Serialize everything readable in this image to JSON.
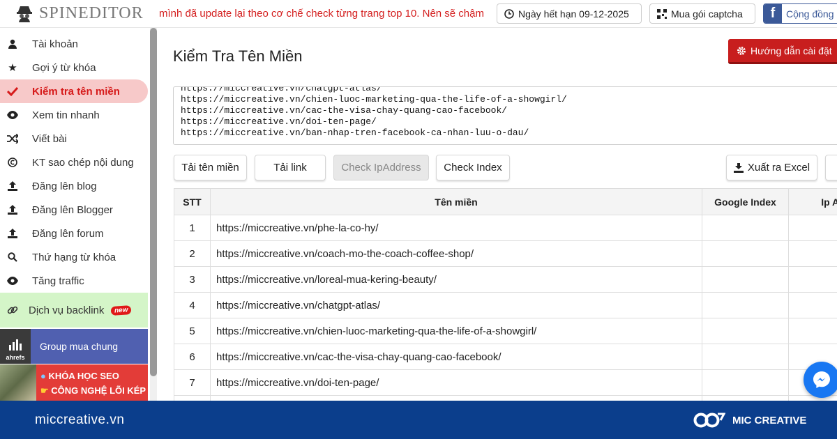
{
  "header": {
    "logo_text": "SPINEDITOR",
    "notice": "mình đã update lại theo cơ chế check từng trang top 10. Nên sẽ chậm",
    "expiry_label": "Ngày hết hạn 09-12-2025",
    "captcha_label": "Mua gói captcha",
    "community_label": "Cộng đồng S"
  },
  "sidebar": {
    "items": [
      {
        "label": "Tài khoản",
        "icon": "user-icon"
      },
      {
        "label": "Gợi ý từ khóa",
        "icon": "star-icon"
      },
      {
        "label": "Kiểm tra tên miền",
        "icon": "check-icon",
        "active": true
      },
      {
        "label": "Xem tin nhanh",
        "icon": "eye-icon"
      },
      {
        "label": "Viết bài",
        "icon": "shuffle-icon"
      },
      {
        "label": "KT sao chép nội dung",
        "icon": "copyright-icon"
      },
      {
        "label": "Đăng lên blog",
        "icon": "upload-icon"
      },
      {
        "label": "Đăng lên Blogger",
        "icon": "upload-icon"
      },
      {
        "label": "Đăng lên forum",
        "icon": "upload-icon"
      },
      {
        "label": "Thứ hạng từ khóa",
        "icon": "search-icon"
      },
      {
        "label": "Tăng traffic",
        "icon": "eye-icon"
      }
    ],
    "backlink_label": "Dịch vụ backlink",
    "new_badge": "new",
    "group_label": "Group mua chung",
    "ahrefs_label": "ahrefs",
    "seo_line1": "KHÓA HỌC SEO",
    "seo_line2": "CÔNG NGHỆ LÕI KÉP"
  },
  "main": {
    "title": "Kiểm Tra Tên Miền",
    "guide_button": "Hướng dẫn cài đặt",
    "url_lines": [
      "https://miccreative.vn/chatgpt-atlas/",
      "https://miccreative.vn/chien-luoc-marketing-qua-the-life-of-a-showgirl/",
      "https://miccreative.vn/cac-the-visa-chay-quang-cao-facebook/",
      "https://miccreative.vn/doi-ten-page/",
      "https://miccreative.vn/ban-nhap-tren-facebook-ca-nhan-luu-o-dau/"
    ],
    "buttons": {
      "load_domains": "Tải tên miền",
      "load_links": "Tải link",
      "check_ip": "Check IpAddress",
      "check_index": "Check Index",
      "export_excel": "Xuất ra Excel"
    },
    "table": {
      "headers": [
        "STT",
        "Tên miền",
        "Google Index",
        "Ip Ad"
      ],
      "rows": [
        {
          "stt": "1",
          "url": "https://miccreative.vn/phe-la-co-hy/"
        },
        {
          "stt": "2",
          "url": "https://miccreative.vn/coach-mo-the-coach-coffee-shop/"
        },
        {
          "stt": "3",
          "url": "https://miccreative.vn/loreal-mua-kering-beauty/"
        },
        {
          "stt": "4",
          "url": "https://miccreative.vn/chatgpt-atlas/"
        },
        {
          "stt": "5",
          "url": "https://miccreative.vn/chien-luoc-marketing-qua-the-life-of-a-showgirl/"
        },
        {
          "stt": "6",
          "url": "https://miccreative.vn/cac-the-visa-chay-quang-cao-facebook/"
        },
        {
          "stt": "7",
          "url": "https://miccreative.vn/doi-ten-page/"
        },
        {
          "stt": "",
          "url": ""
        }
      ]
    }
  },
  "footer": {
    "site": "miccreative.vn",
    "brand": "MIC CREATIVE"
  },
  "colors": {
    "active_bg": "#f7c9c9",
    "active_text": "#d61a1a",
    "footer_bg": "#0b3e8c",
    "guide_button": "#c81e1e"
  }
}
